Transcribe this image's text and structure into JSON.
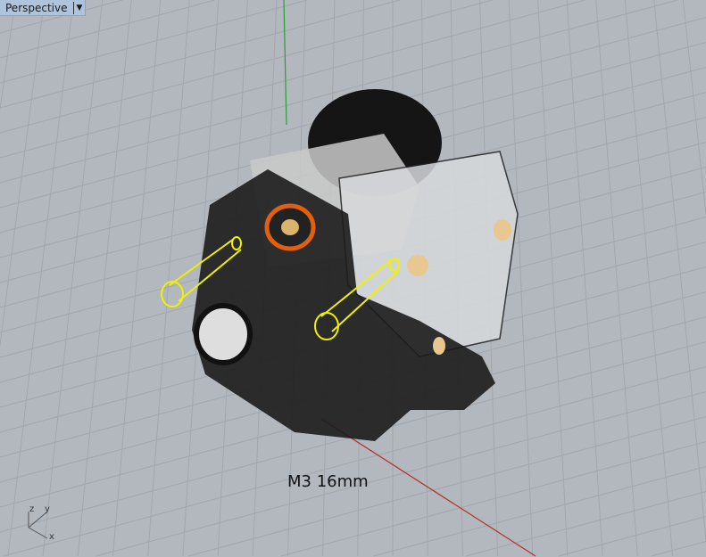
{
  "viewport": {
    "name": "Perspective",
    "menu_icon": "dropdown-arrow-icon"
  },
  "annotation": "M3 16mm",
  "axes": {
    "x": "x",
    "y": "y",
    "z": "z"
  },
  "colors": {
    "background": "#b3b8be",
    "grid": "#a4a9af",
    "x_axis": "#b0302c",
    "y_axis": "#2e9a3a",
    "highlight": "#f0f000",
    "accent": "#e06010"
  }
}
